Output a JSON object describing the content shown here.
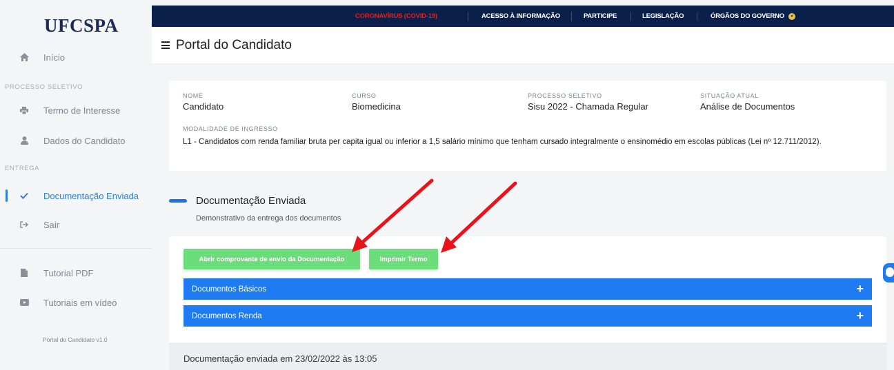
{
  "sidebar": {
    "logo": "UFCSPA",
    "home_label": "Início",
    "section_process": "PROCESSO SELETIVO",
    "item_term": "Termo de Interesse",
    "item_candidate": "Dados do Candidato",
    "section_delivery": "ENTREGA",
    "item_docs": "Documentação Enviada",
    "item_logout": "Sair",
    "item_pdf": "Tutorial PDF",
    "item_videos": "Tutoriais em vídeo",
    "version": "Portal do Candidato v1.0"
  },
  "topbar": {
    "covid": "CORONAVÍRUS (COVID-19)",
    "access": "ACESSO À INFORMAÇÃO",
    "participate": "PARTICIPE",
    "legislation": "LEGISLAÇÃO",
    "government": "ÓRGÃOS DO GOVERNO",
    "chevron": "»"
  },
  "header": {
    "title": "Portal do Candidato"
  },
  "info": {
    "name_label": "NOME",
    "name_value": "Candidato",
    "course_label": "CURSO",
    "course_value": "Biomedicina",
    "process_label": "PROCESSO SELETIVO",
    "process_value": "Sisu 2022 - Chamada Regular",
    "status_label": "SITUAÇÃO ATUAL",
    "status_value": "Análise de Documentos",
    "mode_label": "MODALIDADE DE INGRESSO",
    "mode_value": "L1 - Candidatos com renda familiar bruta per capita igual ou inferior a 1,5 salário mínimo que tenham cursado integralmente o ensinomédio em escolas públicas (Lei nº 12.711/2012)."
  },
  "section": {
    "title": "Documentação Enviada",
    "subtitle": "Demonstrativo da entrega dos documentos"
  },
  "buttons": {
    "open_receipt": "Abrir comprovante de envio da Documentação",
    "print_term": "Imprimir Termo"
  },
  "accordions": {
    "basic": "Documentos Básicos",
    "income": "Documentos Renda",
    "plus": "+"
  },
  "footer": {
    "sent_text": "Documentação enviada em 23/02/2022 às 13:05"
  },
  "colors": {
    "accent": "#1f7bf2",
    "green": "#6ddc7a",
    "topbar": "#0b1f4b",
    "covid": "#e02020",
    "annotation": "#e8131b"
  },
  "icons": [
    "home-icon",
    "printer-icon",
    "user-icon",
    "check-icon",
    "sign-out-icon",
    "file-pdf-icon",
    "video-icon",
    "hamburger-icon",
    "plus-icon",
    "accessibility-icon"
  ]
}
